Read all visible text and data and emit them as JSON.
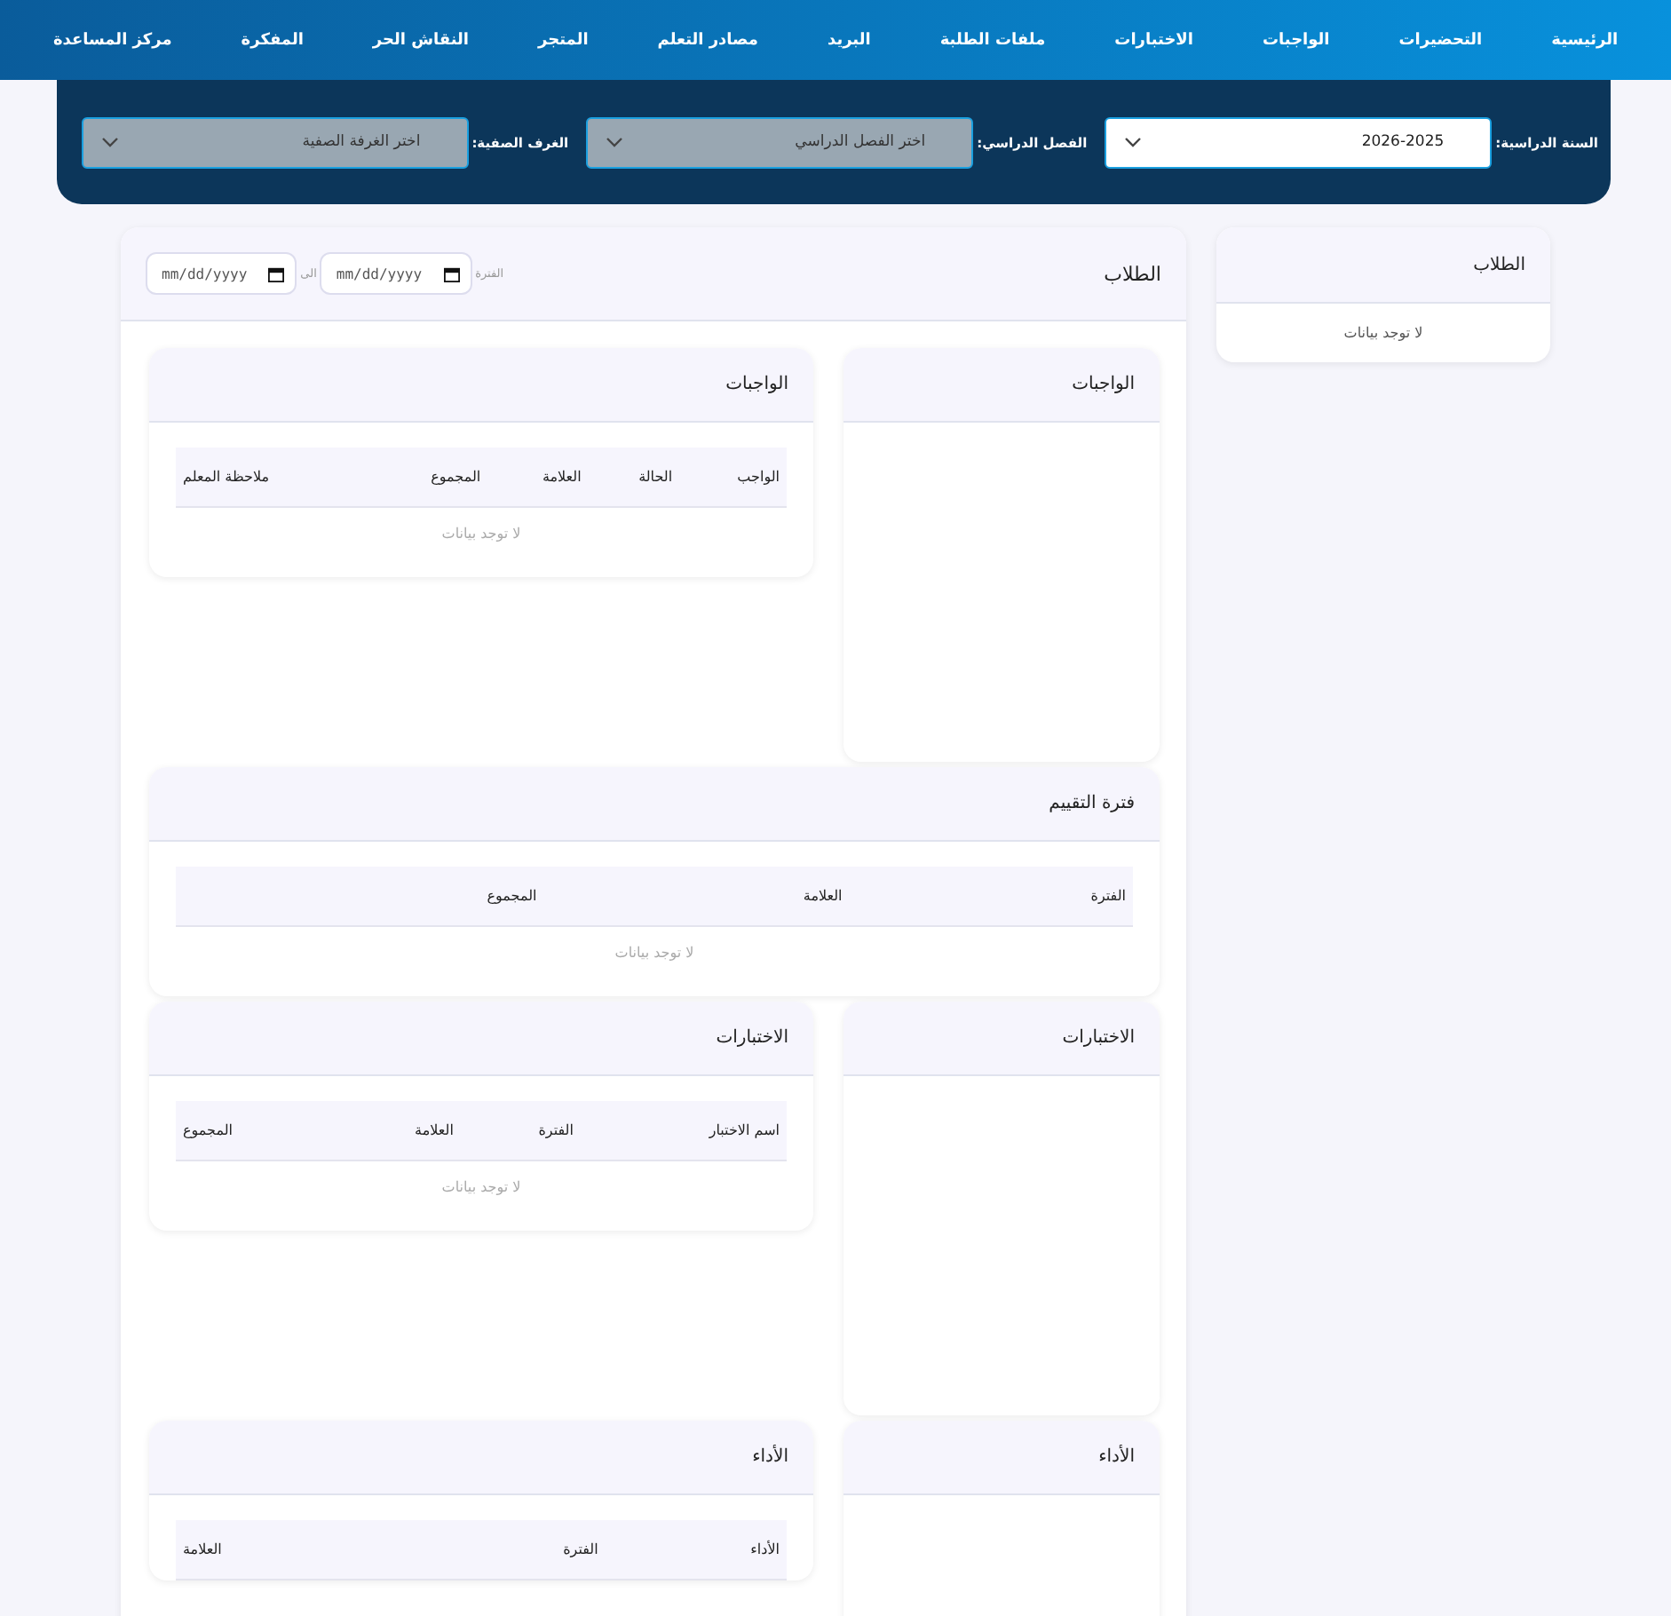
{
  "nav": [
    {
      "label": "الرئيسية"
    },
    {
      "label": "التحضيرات"
    },
    {
      "label": "الواجبات"
    },
    {
      "label": "الاختبارات"
    },
    {
      "label": "ملفات الطلبة"
    },
    {
      "label": "البريد"
    },
    {
      "label": "مصادر التعلم"
    },
    {
      "label": "المتجر"
    },
    {
      "label": "النقاش الحر"
    },
    {
      "label": "المفكرة"
    },
    {
      "label": "مركز المساعدة"
    }
  ],
  "filters": [
    {
      "label": "السنة الدراسية:",
      "value": "2026-2025",
      "disabled": false
    },
    {
      "label": "الفصل الدراسي:",
      "placeholder": "اختر الفصل الدراسي",
      "disabled": true
    },
    {
      "label": "الغرف الصفية:",
      "placeholder": "اختر الغرفة الصفية",
      "disabled": true
    }
  ],
  "side_card": {
    "title": "الطلاب",
    "empty_text": "لا توجد بيانات"
  },
  "main_card": {
    "title": "الطلاب",
    "period_label": "الفترة",
    "from": {
      "placeholder": "mm/dd/yyyy"
    },
    "to_label": "الى",
    "to": {
      "placeholder": "mm/dd/yyyy"
    }
  },
  "panels": [
    {
      "kind": "chart",
      "title": "الواجبات"
    },
    {
      "kind": "table",
      "title": "الواجبات",
      "columns": [
        "الواجب",
        "الحالة",
        "العلامة",
        "المجموع",
        "ملاحظة المعلم"
      ],
      "empty_text": "لا توجد بيانات"
    },
    {
      "kind": "wide-table",
      "title": "فترة التقييم",
      "columns": [
        "الفترة",
        "العلامة",
        "المجموع"
      ],
      "empty_text": "لا توجد بيانات"
    },
    {
      "kind": "chart",
      "title": "الاختبارات"
    },
    {
      "kind": "table",
      "title": "الاختبارات",
      "columns": [
        "اسم الاختبار",
        "الفترة",
        "العلامة",
        "المجموع"
      ],
      "empty_text": "لا توجد بيانات"
    },
    {
      "kind": "chart",
      "title": "الأداء"
    },
    {
      "kind": "table",
      "title": "الأداء",
      "columns": [
        "الأداء",
        "الفترة",
        "العلامة"
      ]
    }
  ]
}
